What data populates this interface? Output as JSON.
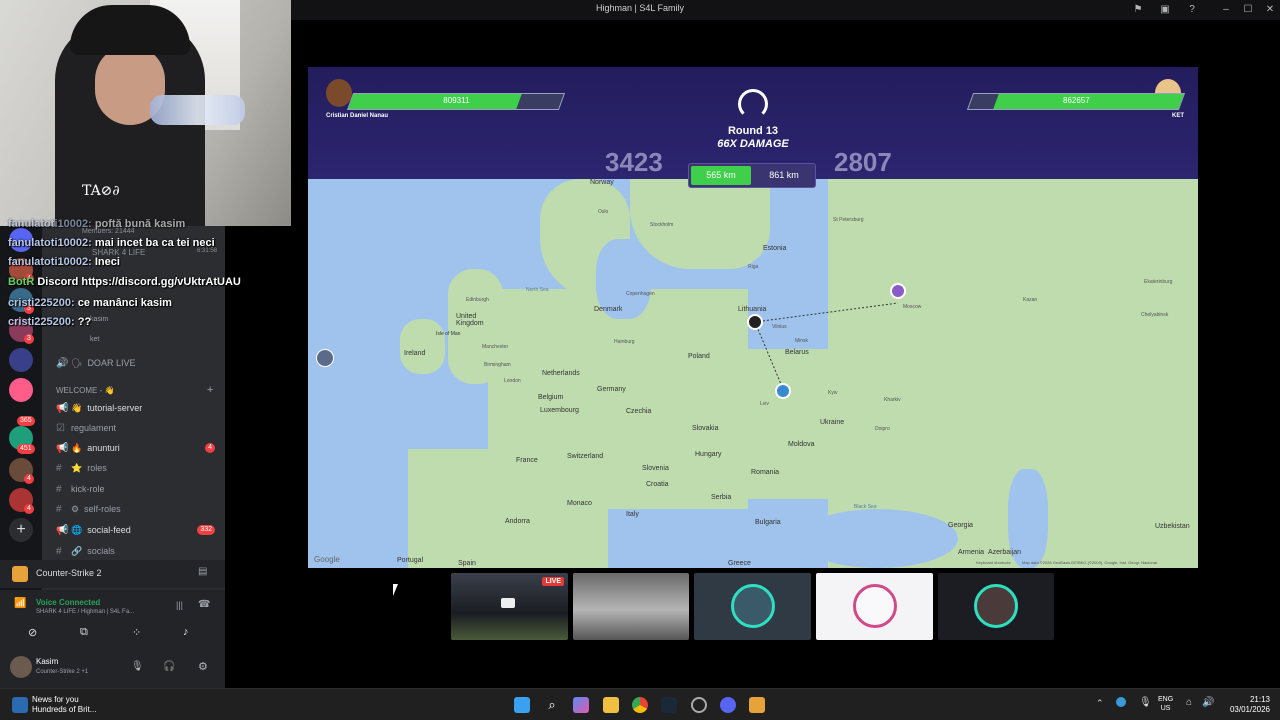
{
  "window": {
    "title": "Highman | S4L Family"
  },
  "webcam": {
    "shirt_text": "TA⊘∂"
  },
  "chat": [
    {
      "nick": "fanulatoti10002:",
      "text": "poftă bună kasim"
    },
    {
      "nick": "fanulatoti10002:",
      "text": "mai incet ba ca tei neci"
    },
    {
      "nick": "fanulatoti10002:",
      "text": "Ineci"
    },
    {
      "nick": "BotR",
      "text": "Discord https://discord.gg/vUktrAtUAU"
    },
    {
      "nick": "cristi225200:",
      "text": "ce manânci kasim"
    },
    {
      "nick": "cristi225200:",
      "text": "??"
    }
  ],
  "discord": {
    "members_line": "Members: 21444",
    "shark_line": "SHARK 4 LIFE",
    "timer": "6:31:58",
    "voice_users": [
      "kasim",
      "ket"
    ],
    "channels": [
      {
        "icon": "voice",
        "emoji": "🗣",
        "label": "DOAR LIVE",
        "badge": ""
      },
      {
        "icon": "category",
        "emoji": "👋",
        "label": "WELCOME - 👋",
        "badge": ""
      },
      {
        "icon": "announce",
        "emoji": "👋",
        "label": "tutorial-server",
        "badge": ""
      },
      {
        "icon": "rules",
        "emoji": "",
        "label": "regulament",
        "badge": ""
      },
      {
        "icon": "announce",
        "emoji": "🔥",
        "label": "anunturi",
        "badge": "4"
      },
      {
        "icon": "hash",
        "emoji": "⭐",
        "label": "roles",
        "badge": ""
      },
      {
        "icon": "hash",
        "emoji": "",
        "label": "kick-role",
        "badge": ""
      },
      {
        "icon": "hash",
        "emoji": "⚙",
        "label": "self-roles",
        "badge": ""
      },
      {
        "icon": "announce",
        "emoji": "🌐",
        "label": "social-feed",
        "badge": "332"
      },
      {
        "icon": "hash",
        "emoji": "🔗",
        "label": "socials",
        "badge": ""
      }
    ],
    "server_badges": [
      "4",
      "3",
      "3",
      "365",
      "451",
      "4",
      "4"
    ],
    "game_activity": "Counter-Strike 2",
    "voice_status": "Voice Connected",
    "voice_channel": "SHARK 4 LIFE / Highman | S4L Fa...",
    "user_name": "Kasim",
    "user_status": "Counter-Strike 2 +1"
  },
  "game": {
    "player_left": {
      "name": "Cristian Daniel Nanau",
      "hp": "809311",
      "hp_fraction": 0.8,
      "score": "3423",
      "distance": "565 km"
    },
    "player_right": {
      "name": "KET",
      "hp": "862657",
      "hp_fraction": 0.88,
      "score": "2807",
      "distance": "861 km"
    },
    "round": "Round 13",
    "damage": "66X DAMAGE",
    "map_footer": "Map data ©2026 GeoBasis-DE/BKG (©2009), Google, Inst. Geogr. Nacional",
    "map_footer_right": "Keyboard shortcuts",
    "google_logo": "Google",
    "countries": [
      {
        "label": "Norway"
      },
      {
        "label": "Estonia"
      },
      {
        "label": "Denmark"
      },
      {
        "label": "Lithuania"
      },
      {
        "label": "United Kingdom"
      },
      {
        "label": "Isle of Man"
      },
      {
        "label": "Ireland"
      },
      {
        "label": "Belarus"
      },
      {
        "label": "Netherlands"
      },
      {
        "label": "Poland"
      },
      {
        "label": "Germany"
      },
      {
        "label": "Belgium"
      },
      {
        "label": "Luxembourg"
      },
      {
        "label": "Czechia"
      },
      {
        "label": "Slovakia"
      },
      {
        "label": "Ukraine"
      },
      {
        "label": "France"
      },
      {
        "label": "Switzerland"
      },
      {
        "label": "Moldova"
      },
      {
        "label": "Hungary"
      },
      {
        "label": "Slovenia"
      },
      {
        "label": "Croatia"
      },
      {
        "label": "Romania"
      },
      {
        "label": "Monaco"
      },
      {
        "label": "Serbia"
      },
      {
        "label": "Andorra"
      },
      {
        "label": "Italy"
      },
      {
        "label": "Bulgaria"
      },
      {
        "label": "Portugal"
      },
      {
        "label": "Spain"
      },
      {
        "label": "Greece"
      },
      {
        "label": "Georgia"
      },
      {
        "label": "Armenia"
      },
      {
        "label": "Azerbaijan"
      },
      {
        "label": "Uzbekistan"
      }
    ],
    "cities": [
      {
        "label": "St Petersburg"
      },
      {
        "label": "Moscow"
      },
      {
        "label": "Kazan"
      },
      {
        "label": "Ekaterinburg"
      },
      {
        "label": "Chelyabinsk"
      },
      {
        "label": "Kyiv"
      },
      {
        "label": "Kharkiv"
      },
      {
        "label": "Dnipro"
      },
      {
        "label": "Vilnius"
      },
      {
        "label": "Minsk"
      },
      {
        "label": "Lviv"
      },
      {
        "label": "Manchester"
      },
      {
        "label": "Birmingham"
      },
      {
        "label": "London"
      },
      {
        "label": "Stockholm"
      },
      {
        "label": "Oslo"
      },
      {
        "label": "Riga"
      },
      {
        "label": "Copenhagen"
      },
      {
        "label": "Edinburgh"
      },
      {
        "label": "Hamburg"
      }
    ],
    "map_water_labels": [
      {
        "label": "North Sea"
      },
      {
        "label": "Black Sea"
      }
    ]
  },
  "thumbnails": [
    {
      "label": "LIVE"
    }
  ],
  "taskbar": {
    "news_title": "News for you",
    "news_sub": "Hundreds of Brit...",
    "lang_top": "ENG",
    "lang_bottom": "US",
    "time": "21:13",
    "date": "03/01/2026"
  },
  "colors": {
    "accent_green": "#3fcf4a",
    "hud_purple": "#2a2469",
    "discord_bg": "#2b2d31"
  }
}
